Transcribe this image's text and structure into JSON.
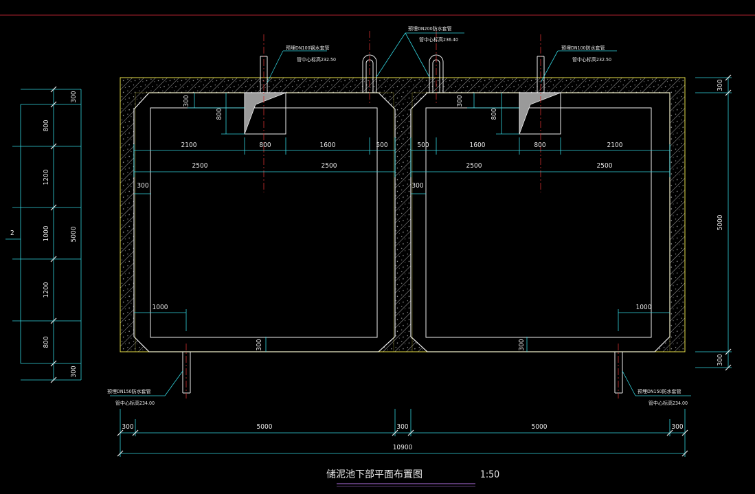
{
  "drawing": {
    "title": "储泥池下部平面布置图",
    "scale": "1:50",
    "section_marker": "2"
  },
  "pipes": {
    "inlet_left": {
      "label": "预埋DN100钢水套管",
      "elevation": "管中心标高232.50"
    },
    "inlet_center": {
      "label": "预埋DN200防水套管",
      "elevation": "管中心标高236.40"
    },
    "inlet_right": {
      "label": "预埋DN100防水套管",
      "elevation": "管中心标高232.50"
    },
    "outlet_left": {
      "label": "预埋DN150防水套管",
      "elevation": "管中心标高234.00"
    },
    "outlet_right": {
      "label": "预埋DN150防水套管",
      "elevation": "管中心标高234.00"
    }
  },
  "dimensions": {
    "top_300_l": "300",
    "top_300_r": "300",
    "hopper_800_l": "800",
    "hopper_800_r": "800",
    "row1_l": [
      "2100",
      "800",
      "1600",
      "500"
    ],
    "row1_r": [
      "500",
      "1600",
      "800",
      "2100"
    ],
    "row2_l": [
      "2500",
      "2500"
    ],
    "row2_r": [
      "2500",
      "2500"
    ],
    "wall_300_l": "300",
    "wall_300_r": "300",
    "b1000_l": "1000",
    "b1000_r": "1000",
    "b300_l": "300",
    "b300_r": "300",
    "left_chain": [
      "300",
      "800",
      "1200",
      "1000",
      "1200",
      "800",
      "300"
    ],
    "left_total": "5000",
    "right_chain": [
      "300",
      "5000",
      "300"
    ],
    "bottom_chain": [
      "300",
      "5000",
      "300",
      "5000",
      "300"
    ],
    "bottom_total": "10900"
  }
}
